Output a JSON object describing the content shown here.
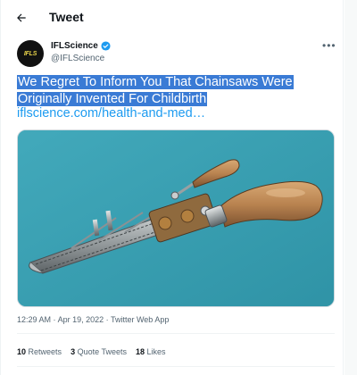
{
  "header": {
    "title": "Tweet",
    "back_icon": "arrow-left-icon"
  },
  "author": {
    "avatar_text": "IFLS",
    "display_name": "IFLScience",
    "handle": "@IFLScience",
    "verified": true,
    "verified_color": "#1d9bf0"
  },
  "tweet": {
    "text_line1": "We Regret To Inform You That Chainsaws Were",
    "text_line2": "Originally Invented For Childbirth",
    "link": "iflscience.com/health-and-med…",
    "image_subject": "antique osteotome chainsaw on teal background"
  },
  "meta": {
    "time": "12:29 AM",
    "date": "Apr 19, 2022",
    "separator": "·",
    "source": "Twitter Web App"
  },
  "stats": {
    "retweets_count": "10",
    "retweets_label": "Retweets",
    "quotes_count": "3",
    "quotes_label": "Quote Tweets",
    "likes_count": "18",
    "likes_label": "Likes"
  },
  "colors": {
    "accent": "#1d9bf0",
    "selection": "#3a7bd5",
    "media_background": "#3aa0b3"
  }
}
